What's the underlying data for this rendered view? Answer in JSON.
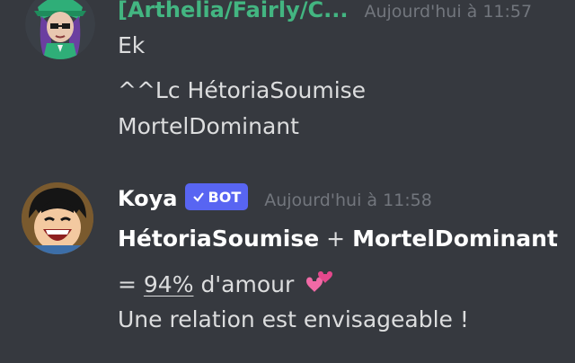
{
  "messages": [
    {
      "author": "[Arthelia/Fairly/C...",
      "author_color": "#43b581",
      "timestamp": "Aujourd'hui à 11:57",
      "lines": [
        "Ek",
        "^^Lc HétoriaSoumise",
        "MortelDominant"
      ]
    },
    {
      "author": "Koya",
      "author_color": "#ffffff",
      "badge": "BOT",
      "timestamp": "Aujourd'hui à 11:58",
      "names": [
        "HétoriaSoumise",
        "MortelDominant"
      ],
      "plus": "+",
      "equals": "=",
      "percent": "94%",
      "love_text": "d'amour",
      "verdict": "Une relation est envisageable !"
    }
  ],
  "colors": {
    "background": "#36393f",
    "text": "#dcddde",
    "muted": "#72767d",
    "badge": "#5865f2"
  }
}
